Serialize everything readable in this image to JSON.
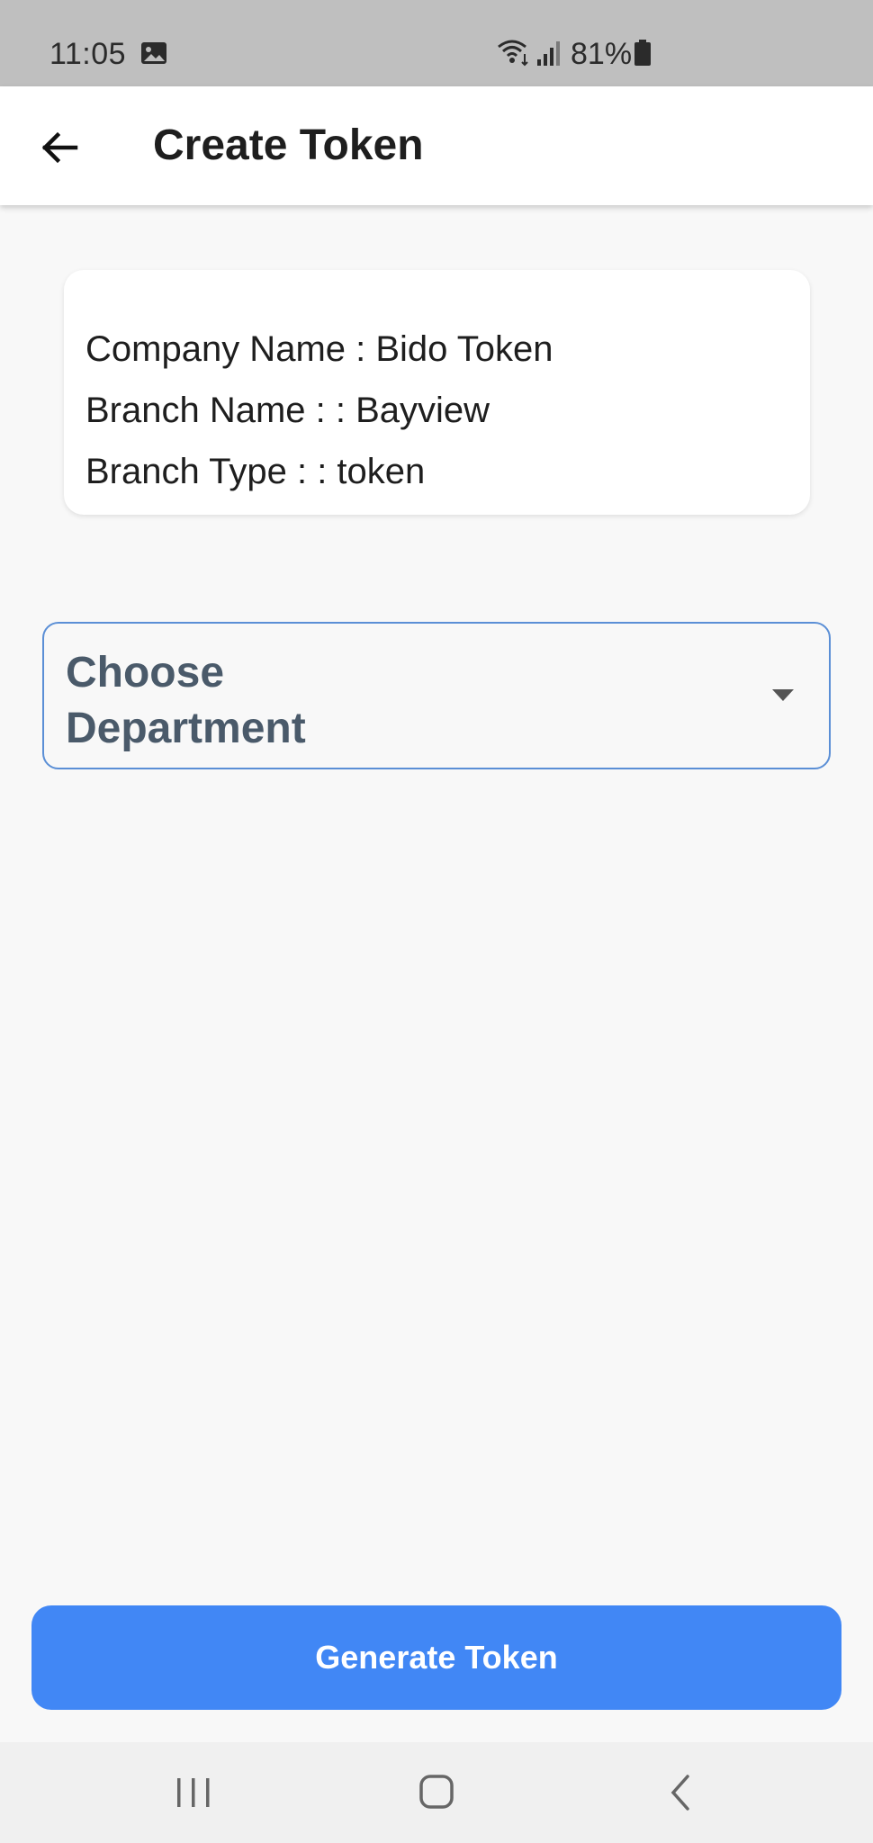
{
  "status_bar": {
    "time": "11:05",
    "battery_percent": "81%",
    "icons": [
      "gallery-icon",
      "wifi-icon",
      "signal-icon",
      "battery-icon"
    ]
  },
  "app_bar": {
    "title": "Create Token",
    "back_icon": "arrow-left-icon"
  },
  "info_card": {
    "company_line": "Company Name : Bido Token",
    "branch_name_line": "Branch Name : : Bayview",
    "branch_type_line": "Branch Type : : token"
  },
  "department_select": {
    "placeholder": "Choose Department",
    "icon": "caret-down-icon"
  },
  "actions": {
    "generate_label": "Generate Token"
  },
  "nav_bar": {
    "icons": [
      "recents-icon",
      "home-icon",
      "back-icon"
    ]
  },
  "colors": {
    "status_bar_bg": "#bfbfbf",
    "page_bg": "#f8f8f8",
    "primary_button": "#4187f5",
    "dropdown_border": "#5b8fd6",
    "dropdown_text": "#4a5a6a"
  }
}
